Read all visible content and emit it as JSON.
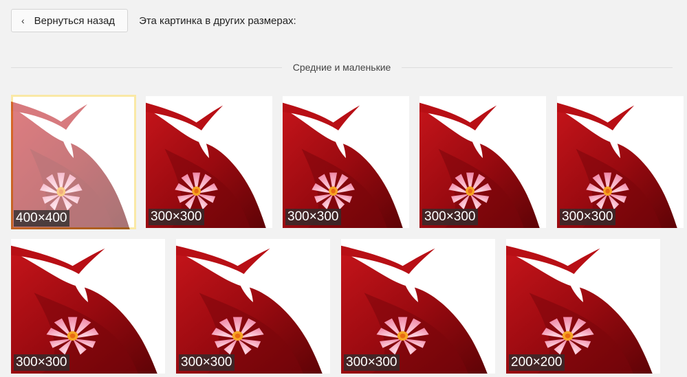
{
  "header": {
    "back_label": "Вернуться назад",
    "other_sizes_label": "Эта картинка в других размерах:"
  },
  "section": {
    "title": "Средние и маленькие"
  },
  "images": [
    {
      "size": "400×400",
      "selected": true
    },
    {
      "size": "300×300"
    },
    {
      "size": "300×300"
    },
    {
      "size": "300×300"
    },
    {
      "size": "300×300"
    },
    {
      "size": "300×300"
    },
    {
      "size": "300×300"
    },
    {
      "size": "300×300"
    },
    {
      "size": "200×200"
    }
  ],
  "colors": {
    "selected_border": "#f5cf3a",
    "ribbon_red": "#a80d12"
  }
}
